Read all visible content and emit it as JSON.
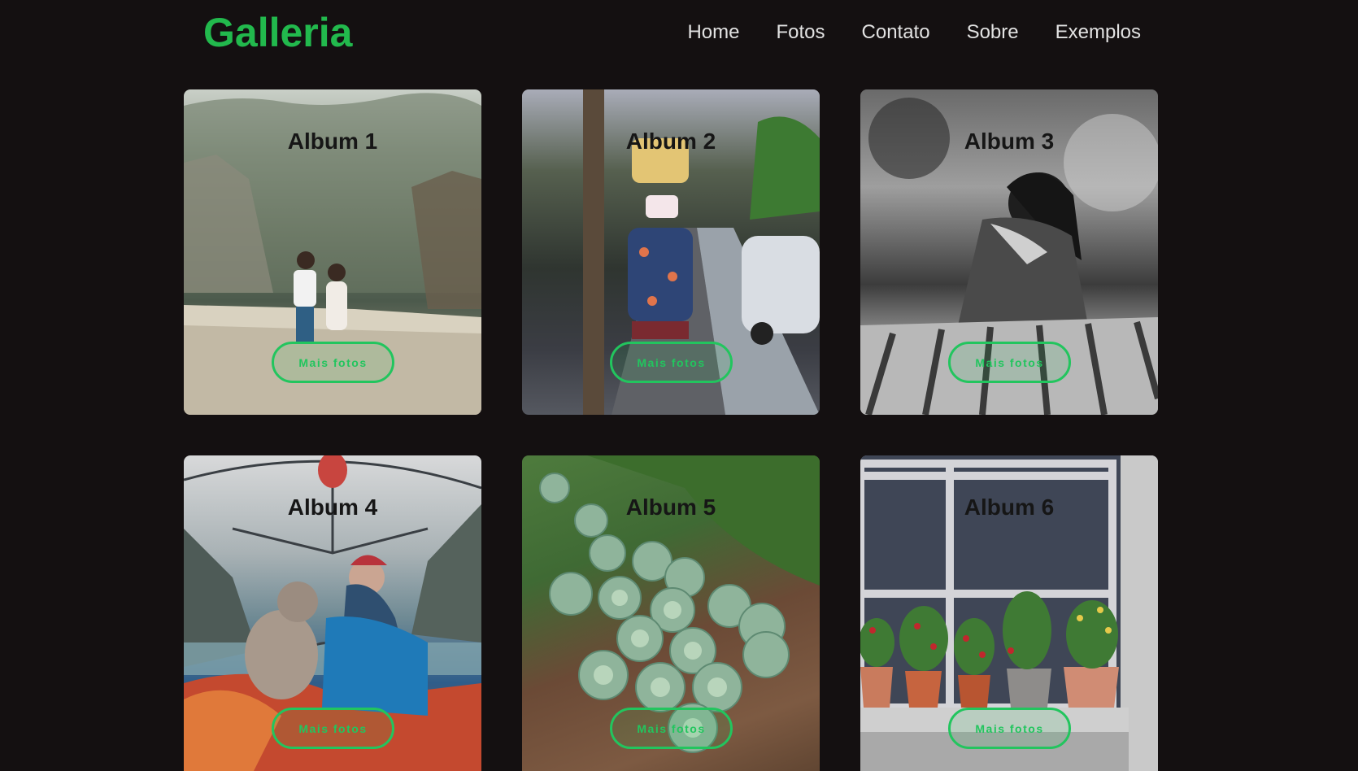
{
  "header": {
    "brand": "Galleria",
    "nav": [
      "Home",
      "Fotos",
      "Contato",
      "Sobre",
      "Exemplos"
    ]
  },
  "albums": [
    {
      "title": "Album 1",
      "button": "Mais fotos"
    },
    {
      "title": "Album 2",
      "button": "Mais fotos"
    },
    {
      "title": "Album 3",
      "button": "Mais fotos"
    },
    {
      "title": "Album 4",
      "button": "Mais fotos"
    },
    {
      "title": "Album 5",
      "button": "Mais fotos"
    },
    {
      "title": "Album 6",
      "button": "Mais fotos"
    }
  ],
  "colors": {
    "background": "#141011",
    "accent": "#22c55e",
    "nav_text": "#e2e2e2"
  }
}
